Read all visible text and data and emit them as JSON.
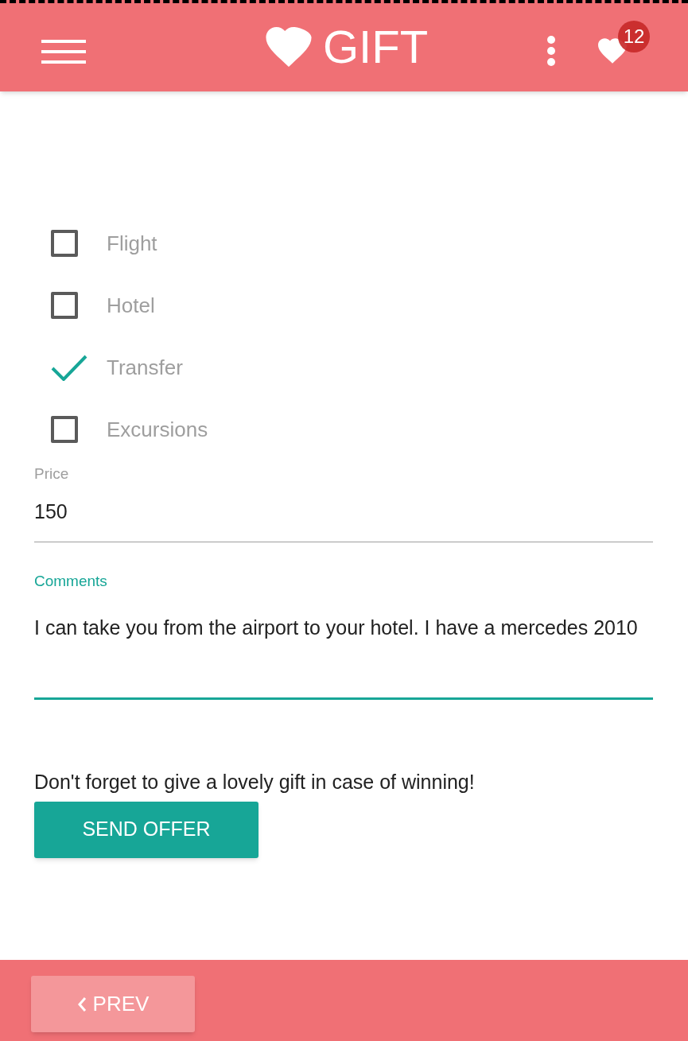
{
  "app_bar": {
    "title": "GIFT",
    "badge": "12"
  },
  "options": [
    {
      "label": "Flight",
      "checked": false
    },
    {
      "label": "Hotel",
      "checked": false
    },
    {
      "label": "Transfer",
      "checked": true
    },
    {
      "label": "Excursions",
      "checked": false
    }
  ],
  "price": {
    "label": "Price",
    "value": "150",
    "focused": false
  },
  "comments": {
    "label": "Comments",
    "value": "I can take you from the airport to your hotel. I have a mercedes 2010",
    "focused": true
  },
  "note": "Don't forget to give a lovely gift in case of winning!",
  "send_button": "SEND OFFER",
  "prev_button": "PREV"
}
